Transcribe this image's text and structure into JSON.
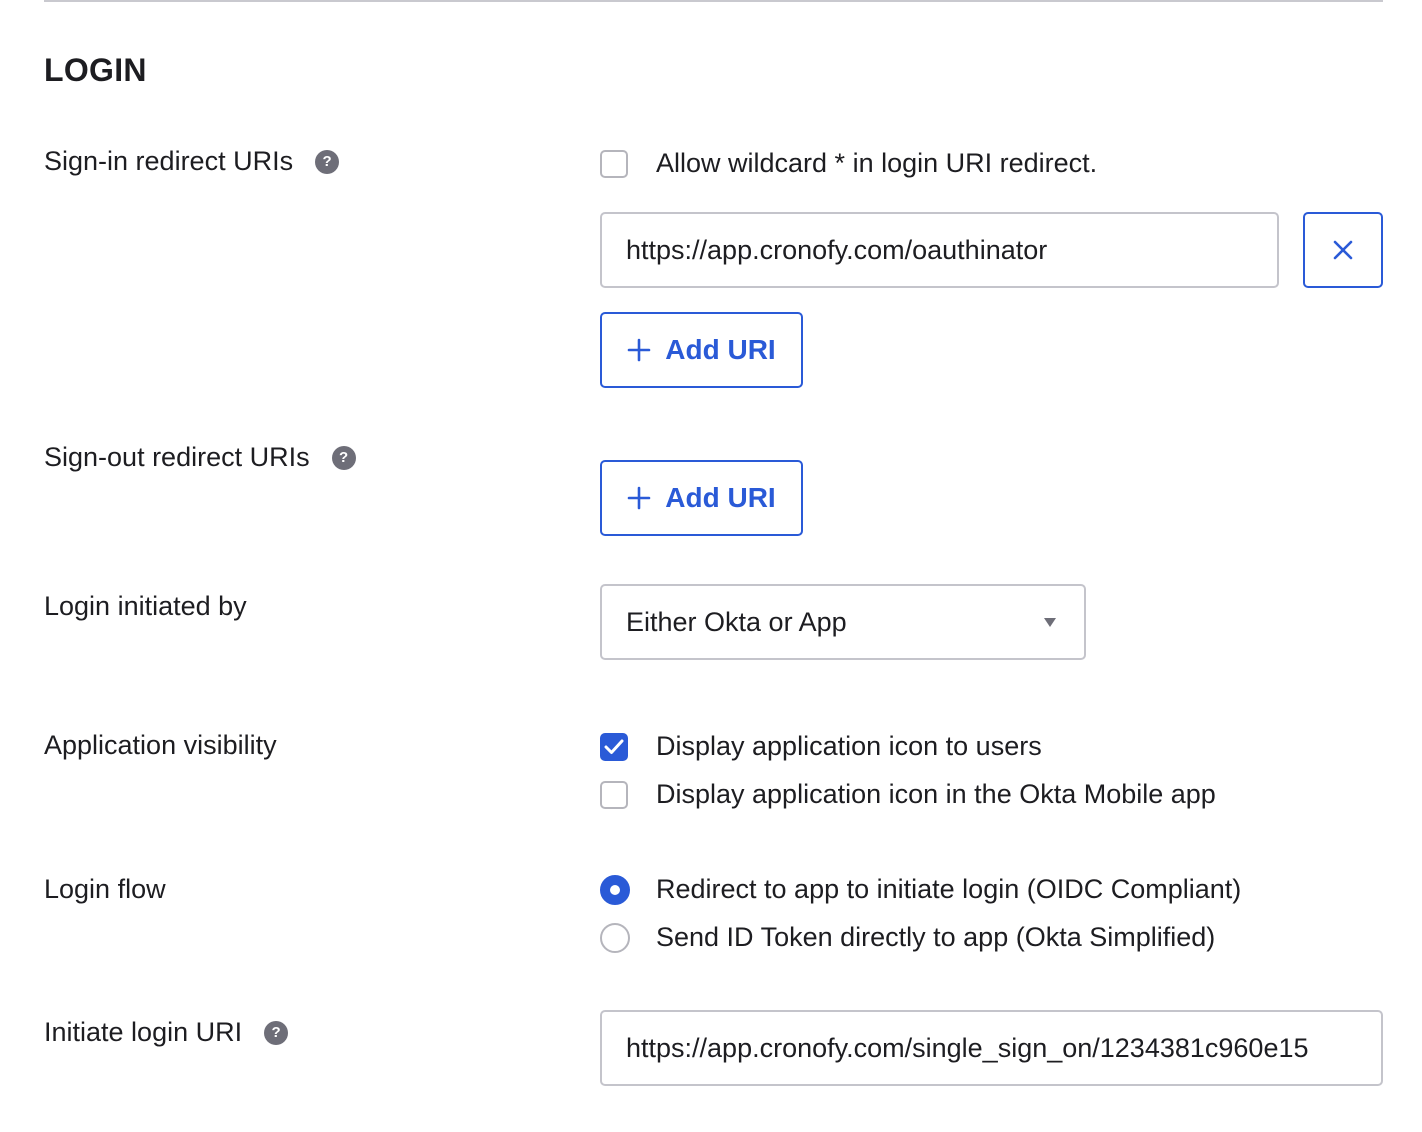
{
  "section": {
    "title": "LOGIN"
  },
  "signin": {
    "label": "Sign-in redirect URIs",
    "wildcard_label": "Allow wildcard * in login URI redirect.",
    "wildcard_checked": false,
    "uri_value": "https://app.cronofy.com/oauthinator",
    "add_label": "Add URI"
  },
  "signout": {
    "label": "Sign-out redirect URIs",
    "add_label": "Add URI"
  },
  "login_initiated": {
    "label": "Login initiated by",
    "selected": "Either Okta or App"
  },
  "visibility": {
    "label": "Application visibility",
    "options": [
      {
        "label": "Display application icon to users",
        "checked": true
      },
      {
        "label": "Display application icon in the Okta Mobile app",
        "checked": false
      }
    ]
  },
  "login_flow": {
    "label": "Login flow",
    "options": [
      {
        "label": "Redirect to app to initiate login (OIDC Compliant)",
        "selected": true
      },
      {
        "label": "Send ID Token directly to app (Okta Simplified)",
        "selected": false
      }
    ]
  },
  "initiate_uri": {
    "label": "Initiate login URI",
    "value": "https://app.cronofy.com/single_sign_on/1234381c960e15"
  },
  "icons": {
    "help": "question-mark-icon",
    "remove": "close-icon",
    "add": "plus-icon",
    "dropdown": "caret-down-icon",
    "check": "checkmark-icon"
  },
  "colors": {
    "accent": "#2a5ad7",
    "text": "#1d1d21",
    "border": "#c4c4cb",
    "help_icon": "#6e6e78"
  }
}
